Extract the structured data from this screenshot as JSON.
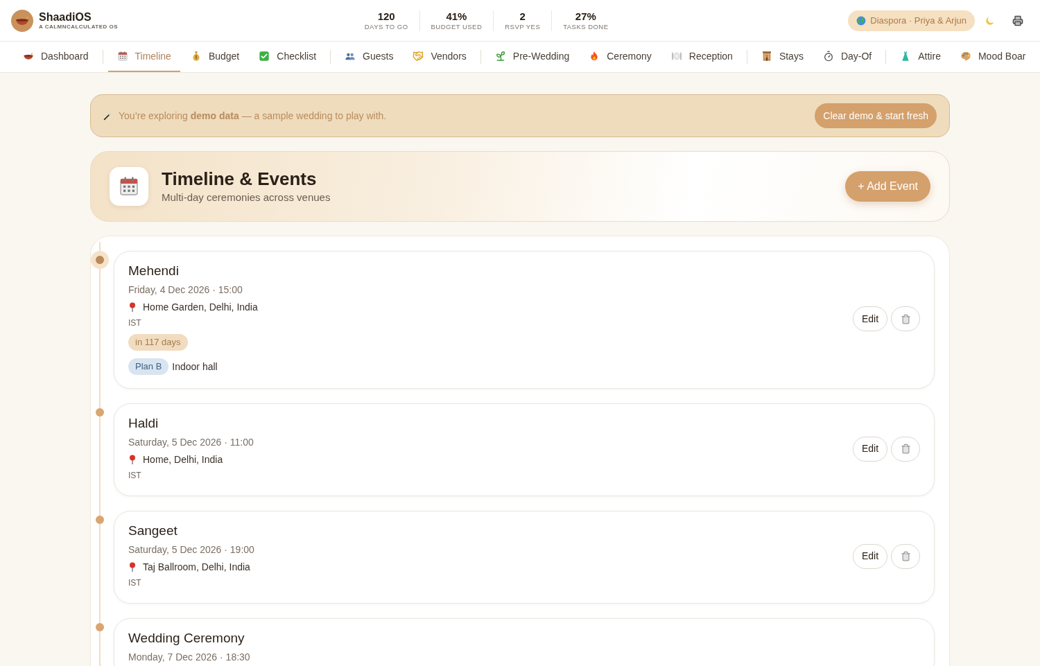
{
  "app": {
    "name": "ShaadiOS",
    "tagline": "A CALMNCALCULATED OS"
  },
  "stats": [
    {
      "value": "120",
      "label": "DAYS TO GO"
    },
    {
      "value": "41%",
      "label": "BUDGET USED"
    },
    {
      "value": "2",
      "label": "RSVP YES"
    },
    {
      "value": "27%",
      "label": "TASKS DONE"
    }
  ],
  "profile_pill": {
    "label": "Diaspora · Priya & Arjun"
  },
  "nav": {
    "groups": [
      [
        {
          "label": "Dashboard",
          "selected": false
        }
      ],
      [
        {
          "label": "Timeline",
          "selected": true
        },
        {
          "label": "Budget",
          "selected": false
        },
        {
          "label": "Checklist",
          "selected": false
        }
      ],
      [
        {
          "label": "Guests",
          "selected": false
        },
        {
          "label": "Vendors",
          "selected": false
        }
      ],
      [
        {
          "label": "Pre-Wedding",
          "selected": false
        },
        {
          "label": "Ceremony",
          "selected": false
        },
        {
          "label": "Reception",
          "selected": false
        }
      ],
      [
        {
          "label": "Stays",
          "selected": false
        },
        {
          "label": "Day-Of",
          "selected": false
        }
      ],
      [
        {
          "label": "Attire",
          "selected": false
        },
        {
          "label": "Mood Boar",
          "selected": false
        }
      ]
    ]
  },
  "demo_banner": {
    "text": "You’re exploring **demo data** — a sample wedding to play with.",
    "button": "Clear demo & start fresh"
  },
  "page_header": {
    "title": "Timeline & Events",
    "subtitle": "Multi-day ceremonies across venues",
    "button": "+ Add Event"
  },
  "events": [
    {
      "title": "Mehendi",
      "date": "Friday, 4 Dec 2026 · 15:00",
      "location": "Home Garden, Delhi, India",
      "timezone": "IST",
      "next": true,
      "countdown": "in 117 days",
      "plan_b": {
        "label": "Plan B",
        "text": "Indoor hall"
      },
      "edit": "Edit"
    },
    {
      "title": "Haldi",
      "date": "Saturday, 5 Dec 2026 · 11:00",
      "location": "Home, Delhi, India",
      "timezone": "IST",
      "next": false,
      "edit": "Edit"
    },
    {
      "title": "Sangeet",
      "date": "Saturday, 5 Dec 2026 · 19:00",
      "location": "Taj Ballroom, Delhi, India",
      "timezone": "IST",
      "next": false,
      "edit": "Edit"
    },
    {
      "title": "Wedding Ceremony",
      "date": "Monday, 7 Dec 2026 · 18:30",
      "next": false
    }
  ]
}
